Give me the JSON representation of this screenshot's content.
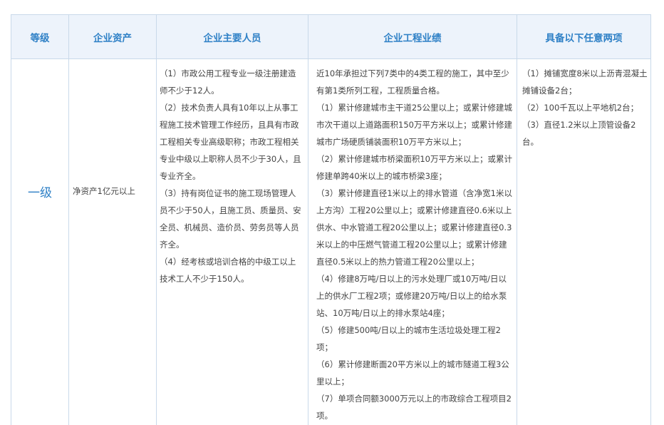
{
  "table": {
    "headers": [
      "等级",
      "企业资产",
      "企业主要人员",
      "企业工程业绩",
      "具备以下任意两项"
    ],
    "row": {
      "level": "一级",
      "assets": "净资产1亿元以上",
      "personnel": [
        "（1）市政公用工程专业一级注册建造师不少于12人。",
        "（2）技术负责人具有10年以上从事工程施工技术管理工作经历，且具有市政工程相关专业高级职称；市政工程相关专业中级以上职称人员不少于30人，且专业齐全。",
        "（3）持有岗位证书的施工现场管理人员不少于50人，且施工员、质量员、安全员、机械员、造价员、劳务员等人员齐全。",
        "（4）经考核或培训合格的中级工以上技术工人不少于150人。"
      ],
      "performance": [
        "近10年承担过下列7类中的4类工程的施工，其中至少有第1类所列工程，工程质量合格。",
        "（1）累计修建城市主干道25公里以上；或累计修建城市次干道以上道路面积150万平方米以上；或累计修建城市广场硬质铺装面积10万平方米以上；",
        "（2）累计修建城市桥梁面积10万平方米以上；或累计修建单跨40米以上的城市桥梁3座；",
        "（3）累计修建直径1米以上的排水管道（含净宽1米以上方沟）工程20公里以上；或累计修建直径0.6米以上供水、中水管道工程20公里以上；或累计修建直径0.3米以上的中压燃气管道工程20公里以上；或累计修建直径0.5米以上的热力管道工程20公里以上；",
        "（4）修建8万吨/日以上的污水处理厂或10万吨/日以上的供水厂工程2项；或修建20万吨/日以上的给水泵站、10万吨/日以上的排水泵站4座；",
        "（5）修建500吨/日以上的城市生活垃圾处理工程2项；",
        "（6）累计修建断面20平方米以上的城市隧道工程3公里以上；",
        "（7）单项合同额3000万元以上的市政综合工程项目2项。"
      ],
      "equipment": [
        "（1）摊铺宽度8米以上沥青混凝土摊铺设备2台；",
        "（2）100千瓦以上平地机2台；",
        "（3）直径1.2米以上顶管设备2台。"
      ]
    }
  }
}
